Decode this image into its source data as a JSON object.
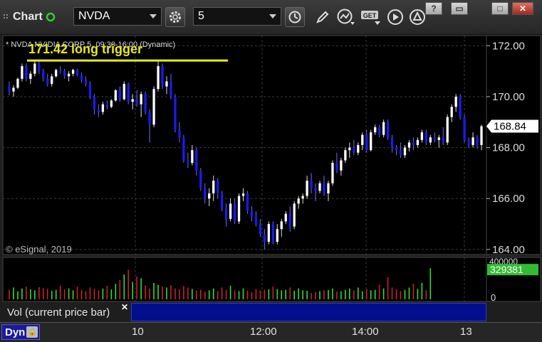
{
  "toolbar": {
    "title": "Chart",
    "symbol": "NVDA",
    "interval": "5",
    "window_buttons": [
      "?",
      "▭",
      "□",
      "✕"
    ],
    "accent": "#33cc33"
  },
  "chart_data": {
    "type": "candlestick",
    "header": "* NVDA NVIDIA CORP 5, 09:30-16:00 (Dynamic)",
    "annotation": "171.42 long trigger",
    "trigger_level": 171.42,
    "copyright": "© eSignal, 2019",
    "last_price": "168.84",
    "ylim": [
      163.8,
      172.4
    ],
    "y_ticks": [
      "172.00",
      "170.00",
      "168.00",
      "166.00",
      "164.00"
    ],
    "x_ticks": [
      "10",
      "12:00",
      "14:00",
      "13"
    ],
    "volume": {
      "label": "Vol (current price bar)",
      "last": "329381",
      "max_label": "400000",
      "zero_label": "0",
      "max": 400000,
      "values": [
        95000,
        120000,
        80000,
        110000,
        130000,
        100000,
        90000,
        125000,
        115000,
        105000,
        85000,
        95000,
        140000,
        100000,
        110000,
        90000,
        130000,
        95000,
        80000,
        120000,
        105000,
        90000,
        110000,
        140000,
        100000,
        160000,
        200000,
        260000,
        310000,
        180000,
        240000,
        220000,
        140000,
        110000,
        170000,
        150000,
        130000,
        120000,
        145000,
        110000,
        100000,
        135000,
        120000,
        105000,
        85000,
        95000,
        75000,
        90000,
        110000,
        80000,
        120000,
        95000,
        140000,
        90000,
        80000,
        110000,
        85000,
        70000,
        105000,
        90000,
        95000,
        100000,
        130000,
        105000,
        90000,
        95000,
        120000,
        85000,
        110000,
        90000,
        85000,
        60000,
        70000,
        80000,
        90000,
        95000,
        110000,
        75000,
        80000,
        95000,
        110000,
        90000,
        120000,
        80000,
        100000,
        90000,
        95000,
        150000,
        110000,
        230000,
        120000,
        100000,
        80000,
        95000,
        120000,
        160000,
        105000,
        170000,
        90000,
        329381
      ],
      "up_color": "#33dd33",
      "down_color": "#cc2222"
    },
    "candles": [
      [
        170.4,
        170.6,
        170.05,
        170.2
      ],
      [
        170.2,
        170.45,
        170.0,
        170.35
      ],
      [
        170.35,
        170.75,
        170.3,
        170.7
      ],
      [
        170.7,
        171.3,
        170.6,
        171.2
      ],
      [
        171.2,
        171.3,
        170.6,
        170.7
      ],
      [
        170.7,
        171.0,
        170.5,
        170.9
      ],
      [
        170.9,
        171.4,
        170.8,
        171.3
      ],
      [
        171.3,
        171.45,
        170.9,
        171.0
      ],
      [
        171.0,
        171.1,
        170.6,
        170.7
      ],
      [
        170.7,
        170.9,
        170.4,
        170.5
      ],
      [
        170.5,
        170.9,
        170.4,
        170.8
      ],
      [
        170.8,
        171.1,
        170.75,
        171.05
      ],
      [
        171.05,
        171.2,
        170.9,
        171.0
      ],
      [
        171.0,
        171.1,
        170.7,
        170.8
      ],
      [
        170.8,
        171.0,
        170.6,
        170.9
      ],
      [
        170.9,
        171.1,
        170.8,
        171.05
      ],
      [
        171.05,
        171.1,
        170.8,
        170.85
      ],
      [
        170.85,
        170.95,
        170.55,
        170.65
      ],
      [
        170.65,
        170.8,
        170.4,
        170.5
      ],
      [
        170.5,
        170.6,
        169.9,
        170.0
      ],
      [
        170.0,
        170.1,
        169.3,
        169.5
      ],
      [
        169.5,
        169.7,
        169.2,
        169.4
      ],
      [
        169.4,
        169.8,
        169.3,
        169.7
      ],
      [
        169.7,
        169.85,
        169.5,
        169.6
      ],
      [
        169.6,
        169.9,
        169.55,
        169.85
      ],
      [
        169.85,
        170.3,
        169.8,
        170.25
      ],
      [
        170.25,
        170.4,
        169.8,
        169.9
      ],
      [
        169.9,
        170.6,
        169.85,
        170.5
      ],
      [
        170.5,
        170.55,
        169.7,
        169.8
      ],
      [
        169.8,
        170.1,
        169.5,
        169.9
      ],
      [
        169.9,
        170.25,
        169.6,
        169.7
      ],
      [
        169.7,
        170.2,
        169.2,
        170.1
      ],
      [
        170.1,
        170.2,
        169.3,
        169.4
      ],
      [
        169.4,
        169.5,
        168.2,
        168.9
      ],
      [
        168.9,
        170.4,
        168.8,
        170.3
      ],
      [
        170.3,
        171.4,
        170.2,
        171.2
      ],
      [
        171.2,
        171.3,
        170.3,
        170.4
      ],
      [
        170.4,
        170.8,
        170.1,
        170.6
      ],
      [
        170.6,
        170.9,
        169.9,
        170.0
      ],
      [
        170.0,
        170.1,
        168.6,
        168.7
      ],
      [
        168.7,
        169.0,
        168.2,
        168.4
      ],
      [
        168.4,
        168.5,
        167.4,
        167.5
      ],
      [
        167.5,
        167.8,
        167.2,
        167.4
      ],
      [
        167.4,
        168.1,
        167.3,
        167.9
      ],
      [
        167.9,
        168.0,
        166.9,
        167.1
      ],
      [
        167.1,
        167.2,
        166.3,
        166.4
      ],
      [
        166.4,
        166.6,
        165.8,
        166.0
      ],
      [
        166.0,
        166.4,
        165.7,
        166.2
      ],
      [
        166.2,
        166.9,
        165.9,
        166.7
      ],
      [
        166.7,
        166.8,
        166.0,
        166.2
      ],
      [
        166.2,
        166.3,
        165.5,
        165.6
      ],
      [
        165.6,
        165.8,
        164.9,
        165.2
      ],
      [
        165.2,
        166.0,
        165.1,
        165.8
      ],
      [
        165.8,
        166.0,
        165.0,
        165.1
      ],
      [
        165.1,
        166.2,
        165.0,
        166.1
      ],
      [
        166.1,
        166.4,
        165.9,
        166.2
      ],
      [
        166.2,
        166.3,
        165.4,
        165.5
      ],
      [
        165.5,
        165.7,
        165.1,
        165.3
      ],
      [
        165.3,
        165.5,
        164.9,
        165.0
      ],
      [
        165.0,
        165.2,
        164.5,
        164.6
      ],
      [
        164.6,
        164.8,
        164.0,
        164.3
      ],
      [
        164.3,
        165.1,
        164.2,
        165.0
      ],
      [
        165.0,
        165.1,
        164.2,
        164.3
      ],
      [
        164.3,
        165.0,
        164.2,
        164.8
      ],
      [
        164.8,
        165.2,
        164.5,
        165.1
      ],
      [
        165.1,
        165.5,
        165.0,
        165.4
      ],
      [
        165.4,
        165.7,
        164.7,
        164.9
      ],
      [
        164.9,
        165.9,
        164.8,
        165.8
      ],
      [
        165.8,
        166.1,
        165.6,
        166.0
      ],
      [
        166.0,
        166.2,
        165.8,
        166.1
      ],
      [
        166.1,
        166.9,
        166.0,
        166.7
      ],
      [
        166.7,
        167.0,
        166.2,
        166.4
      ],
      [
        166.4,
        166.6,
        165.9,
        166.3
      ],
      [
        166.3,
        166.7,
        166.2,
        166.6
      ],
      [
        166.6,
        166.9,
        166.1,
        166.2
      ],
      [
        166.2,
        166.7,
        165.9,
        166.6
      ],
      [
        166.6,
        167.5,
        166.5,
        167.4
      ],
      [
        167.4,
        167.8,
        167.0,
        167.1
      ],
      [
        167.1,
        167.6,
        166.9,
        167.5
      ],
      [
        167.5,
        168.0,
        167.4,
        167.9
      ],
      [
        167.9,
        168.2,
        167.6,
        168.0
      ],
      [
        168.0,
        168.3,
        167.7,
        167.8
      ],
      [
        167.8,
        168.2,
        167.7,
        168.1
      ],
      [
        168.1,
        168.6,
        167.9,
        168.5
      ],
      [
        168.5,
        168.7,
        167.8,
        167.9
      ],
      [
        167.9,
        168.7,
        167.85,
        168.6
      ],
      [
        168.6,
        168.9,
        168.5,
        168.8
      ],
      [
        168.8,
        168.9,
        168.4,
        168.5
      ],
      [
        168.5,
        169.1,
        168.4,
        169.0
      ],
      [
        169.0,
        169.1,
        168.3,
        168.4
      ],
      [
        168.4,
        168.5,
        167.8,
        168.0
      ],
      [
        168.0,
        168.1,
        167.7,
        167.9
      ],
      [
        167.9,
        168.2,
        167.6,
        167.7
      ],
      [
        167.7,
        168.1,
        167.6,
        168.0
      ],
      [
        168.0,
        168.3,
        167.85,
        168.2
      ],
      [
        168.2,
        168.4,
        167.9,
        168.1
      ],
      [
        168.1,
        168.4,
        168.0,
        168.3
      ],
      [
        168.3,
        168.7,
        168.2,
        168.6
      ],
      [
        168.6,
        168.7,
        168.1,
        168.2
      ],
      [
        168.2,
        168.5,
        168.1,
        168.4
      ],
      [
        168.4,
        168.6,
        168.2,
        168.3
      ],
      [
        168.3,
        168.5,
        168.0,
        168.4
      ],
      [
        168.4,
        168.8,
        168.1,
        168.2
      ],
      [
        168.2,
        169.3,
        168.1,
        169.2
      ],
      [
        169.2,
        169.7,
        169.0,
        169.6
      ],
      [
        169.6,
        170.1,
        169.4,
        170.0
      ],
      [
        170.0,
        170.1,
        169.1,
        169.2
      ],
      [
        169.2,
        169.3,
        168.2,
        168.3
      ],
      [
        168.3,
        168.4,
        168.0,
        168.1
      ],
      [
        168.1,
        168.6,
        168.0,
        168.4
      ],
      [
        168.4,
        168.5,
        167.95,
        168.1
      ],
      [
        168.1,
        168.9,
        167.9,
        168.84
      ]
    ],
    "up_fill": "#ffffff",
    "down_fill": "#1a1aee",
    "trigger_color": "#e8e824",
    "last_price_bg": "#ffffff"
  },
  "status": {
    "mode": "Dyn"
  }
}
